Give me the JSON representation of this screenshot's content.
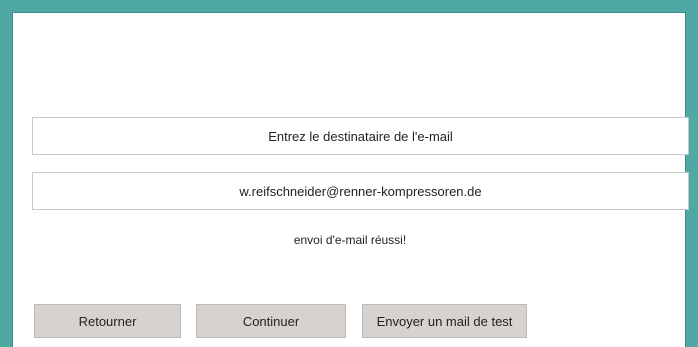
{
  "recipient_label": "Entrez le destinataire de l'e-mail",
  "recipient": {
    "value": "w.reifschneider@renner-kompressoren.de"
  },
  "status_message": "envoi d'e-mail réussi!",
  "buttons": {
    "back": "Retourner",
    "continue": "Continuer",
    "send_test": "Envoyer un mail de test"
  },
  "colors": {
    "frame": "#4fa8a4",
    "button_bg": "#d6d3cf"
  }
}
